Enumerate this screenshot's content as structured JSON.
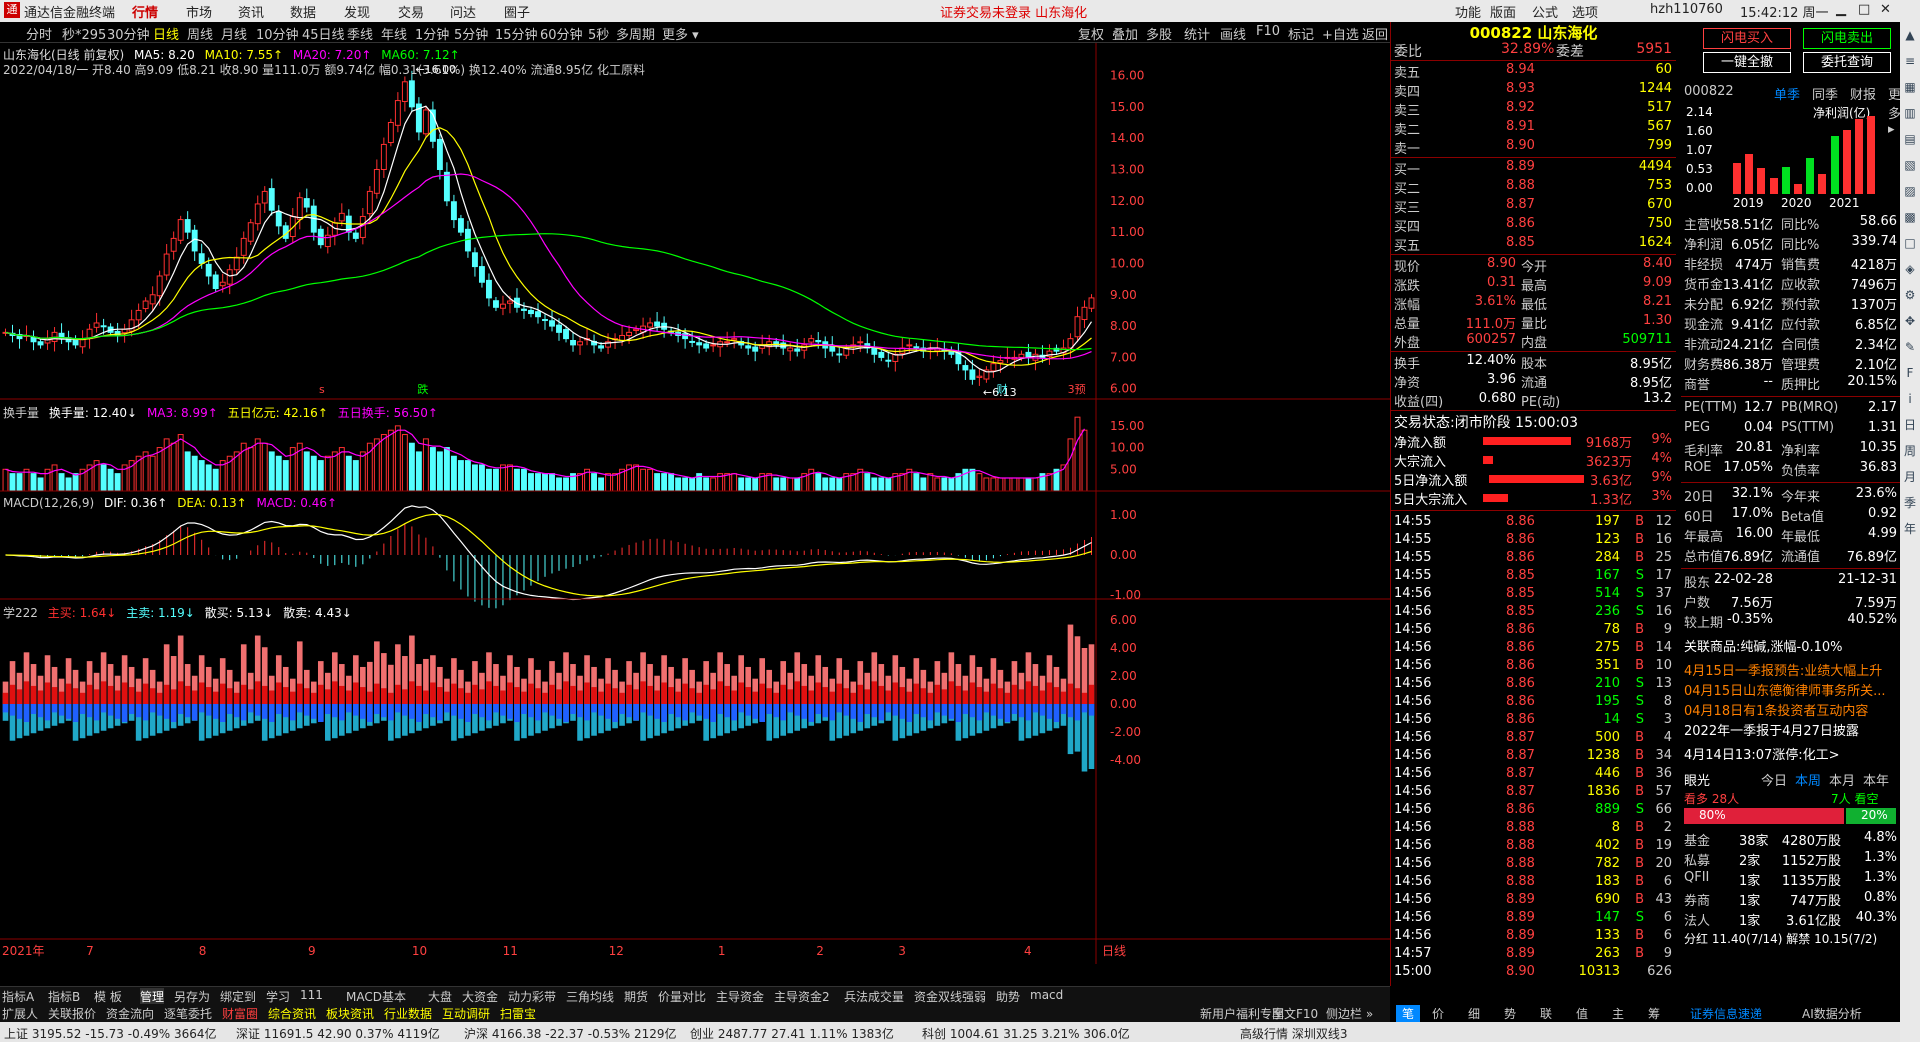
{
  "app": {
    "title": "通达信金融终端",
    "menu": [
      "行情",
      "市场",
      "资讯",
      "数据",
      "发现",
      "交易",
      "问达",
      "圈子"
    ],
    "notice": "证券交易未登录  山东海化",
    "right_menu": [
      "功能",
      "版面",
      "公式",
      "选项"
    ],
    "user": "hzh110760",
    "clock": "15:42:12 周一"
  },
  "periods": [
    "分时",
    "秒*295",
    "30分钟",
    "日线",
    "周线",
    "月线",
    "10分钟",
    "45日线",
    "季线",
    "年线",
    "1分钟",
    "5分钟",
    "15分钟",
    "60分钟",
    "5秒",
    "多周期",
    "更多 ▾"
  ],
  "toolbar": [
    "复权",
    "叠加",
    "多股",
    "统计",
    "画线",
    "F10",
    "标记",
    "+自选",
    "返回"
  ],
  "chart_header": {
    "title": "山东海化(日线 前复权)",
    "ma5": "MA5: 8.20",
    "ma10": "MA10: 7.55↑",
    "ma20": "MA20: 7.20↑",
    "ma60": "MA60: 7.12↑",
    "line2": "2022/04/18/一 开8.40 高9.09 低8.21 收8.90 量111.0万 额9.74亿 幅0.31(3.61%) 换12.40% 流通8.95亿 化工原料"
  },
  "price_axis": [
    "16.00",
    "15.00",
    "14.00",
    "13.00",
    "12.00",
    "11.00",
    "10.00",
    "9.00",
    "8.00",
    "7.00",
    "6.00"
  ],
  "annotations": {
    "high": "16.00",
    "low": "6.13",
    "marks": [
      "s",
      "跌",
      "财",
      "3预"
    ]
  },
  "vol_header": {
    "name": "换手量",
    "val": "换手量: 12.40↓",
    "ma3": "MA3: 8.99↑",
    "d5": "五日亿元: 42.16↑",
    "h5": "五日换手: 56.50↑"
  },
  "vol_axis": [
    "15.00",
    "10.00",
    "5.00"
  ],
  "macd_header": {
    "name": "MACD(12,26,9)",
    "dif": "DIF: 0.36↑",
    "dea": "DEA: 0.13↑",
    "macd": "MACD: 0.46↑"
  },
  "macd_axis": [
    "1.00",
    "0.00",
    "-1.00"
  ],
  "flow_header": {
    "name": "学222",
    "buy": "主买: 1.64↓",
    "sell": "主卖: 1.19↓",
    "sb": "散买: 5.13↓",
    "ss": "散卖: 4.43↓"
  },
  "flow_axis": [
    "6.00",
    "4.00",
    "2.00",
    "0.00",
    "-2.00",
    "-4.00"
  ],
  "x_axis": [
    "2021年",
    "7",
    "8",
    "9",
    "10",
    "11",
    "12",
    "1",
    "2",
    "3",
    "4",
    "日线"
  ],
  "right": {
    "code": "000822 山东海化",
    "wb": {
      "lbl": "委比",
      "v1": "32.89%",
      "lbl2": "委差",
      "v2": "5951"
    },
    "sells": [
      {
        "l": "卖五",
        "p": "8.94",
        "v": "60"
      },
      {
        "l": "卖四",
        "p": "8.93",
        "v": "1244"
      },
      {
        "l": "卖三",
        "p": "8.92",
        "v": "517"
      },
      {
        "l": "卖二",
        "p": "8.91",
        "v": "567"
      },
      {
        "l": "卖一",
        "p": "8.90",
        "v": "799"
      }
    ],
    "buys": [
      {
        "l": "买一",
        "p": "8.89",
        "v": "4494"
      },
      {
        "l": "买二",
        "p": "8.88",
        "v": "753"
      },
      {
        "l": "买三",
        "p": "8.87",
        "v": "670"
      },
      {
        "l": "买四",
        "p": "8.86",
        "v": "750"
      },
      {
        "l": "买五",
        "p": "8.85",
        "v": "1624"
      }
    ],
    "quote": [
      [
        "现价",
        "8.90",
        "今开",
        "8.40"
      ],
      [
        "涨跌",
        "0.31",
        "最高",
        "9.09"
      ],
      [
        "涨幅",
        "3.61%",
        "最低",
        "8.21"
      ],
      [
        "总量",
        "111.0万",
        "量比",
        "1.30"
      ],
      [
        "外盘",
        "600257",
        "内盘",
        "509711"
      ]
    ],
    "quote2": [
      [
        "换手",
        "12.40%",
        "股本",
        "8.95亿"
      ],
      [
        "净资",
        "3.96",
        "流通",
        "8.95亿"
      ],
      [
        "收益(四)",
        "0.680",
        "PE(动)",
        "13.2"
      ]
    ],
    "status": "交易状态:闭市阶段 15:00:03",
    "flows": [
      [
        "净流入额",
        "9168万",
        "9%"
      ],
      [
        "大宗流入",
        "3623万",
        "4%"
      ],
      [
        "5日净流入额",
        "3.63亿",
        "9%"
      ],
      [
        "5日大宗流入",
        "1.33亿",
        "3%"
      ]
    ],
    "ticks": [
      [
        "14:55",
        "8.86",
        "197",
        "B",
        "12"
      ],
      [
        "14:55",
        "8.86",
        "123",
        "B",
        "16"
      ],
      [
        "14:55",
        "8.86",
        "284",
        "B",
        "25"
      ],
      [
        "14:55",
        "8.85",
        "167",
        "S",
        "17"
      ],
      [
        "14:56",
        "8.85",
        "514",
        "S",
        "37"
      ],
      [
        "14:56",
        "8.85",
        "236",
        "S",
        "16"
      ],
      [
        "14:56",
        "8.86",
        "78",
        "B",
        "9"
      ],
      [
        "14:56",
        "8.86",
        "275",
        "B",
        "14"
      ],
      [
        "14:56",
        "8.86",
        "351",
        "B",
        "10"
      ],
      [
        "14:56",
        "8.86",
        "210",
        "S",
        "13"
      ],
      [
        "14:56",
        "8.86",
        "195",
        "S",
        "8"
      ],
      [
        "14:56",
        "8.86",
        "14",
        "S",
        "3"
      ],
      [
        "14:56",
        "8.87",
        "500",
        "B",
        "4"
      ],
      [
        "14:56",
        "8.87",
        "1238",
        "B",
        "34"
      ],
      [
        "14:56",
        "8.87",
        "446",
        "B",
        "36"
      ],
      [
        "14:56",
        "8.87",
        "1836",
        "B",
        "57"
      ],
      [
        "14:56",
        "8.86",
        "889",
        "S",
        "66"
      ],
      [
        "14:56",
        "8.88",
        "8",
        "B",
        "2"
      ],
      [
        "14:56",
        "8.88",
        "402",
        "B",
        "19"
      ],
      [
        "14:56",
        "8.88",
        "782",
        "B",
        "20"
      ],
      [
        "14:56",
        "8.88",
        "183",
        "B",
        "6"
      ],
      [
        "14:56",
        "8.89",
        "690",
        "B",
        "43"
      ],
      [
        "14:56",
        "8.89",
        "147",
        "S",
        "6"
      ],
      [
        "14:56",
        "8.89",
        "133",
        "B",
        "6"
      ],
      [
        "14:57",
        "8.89",
        "263",
        "B",
        "9"
      ],
      [
        "15:00",
        "8.90",
        "10313",
        "",
        "626"
      ]
    ],
    "buttons": [
      "闪电买入",
      "闪电卖出",
      "一键全撤",
      "委托查询"
    ],
    "fin_tabs": [
      "000822",
      "单季",
      "同季",
      "财报",
      "更多 ▸"
    ],
    "fin_axis": [
      "2.14",
      "1.60",
      "1.07",
      "0.53",
      "0.00"
    ],
    "fin_title": "净利润(亿)",
    "fin_years": [
      "2019",
      "2020",
      "2021"
    ],
    "fin_bars": [
      {
        "v": 0.85,
        "c": "#ff3030"
      },
      {
        "v": 1.1,
        "c": "#ff3030"
      },
      {
        "v": 0.7,
        "c": "#ff3030"
      },
      {
        "v": 0.45,
        "c": "#ff3030"
      },
      {
        "v": 0.75,
        "c": "#00e020"
      },
      {
        "v": 0.28,
        "c": "#ff3030"
      },
      {
        "v": 1.0,
        "c": "#00e020"
      },
      {
        "v": 0.55,
        "c": "#ff3030"
      },
      {
        "v": 1.6,
        "c": "#00e020"
      },
      {
        "v": 1.75,
        "c": "#ff3030"
      },
      {
        "v": 2.05,
        "c": "#ff3030"
      },
      {
        "v": 2.14,
        "c": "#ff3030"
      }
    ],
    "fin": [
      [
        "主营收",
        "58.51亿",
        "同比%",
        "58.66"
      ],
      [
        "净利润",
        "6.05亿",
        "同比%",
        "339.74"
      ],
      [
        "非经损",
        "474万",
        "销售费",
        "4218万"
      ],
      [
        "货币金",
        "13.41亿",
        "应收款",
        "7496万"
      ],
      [
        "未分配",
        "6.92亿",
        "预付款",
        "1370万"
      ],
      [
        "现金流",
        "9.41亿",
        "应付款",
        "6.85亿"
      ],
      [
        "非流动",
        "24.21亿",
        "合同债",
        "2.34亿"
      ],
      [
        "财务费",
        "-86.38万",
        "管理费",
        "2.10亿"
      ],
      [
        "商誉",
        "--",
        "质押比",
        "20.15%"
      ],
      [
        "PE(TTM)",
        "12.7",
        "PB(MRQ)",
        "2.17"
      ],
      [
        "PEG",
        "0.04",
        "PS(TTM)",
        "1.31"
      ],
      [
        "毛利率",
        "20.81",
        "净利率",
        "10.35"
      ],
      [
        "ROE",
        "17.05%",
        "负债率",
        "36.83"
      ],
      [
        "20日",
        "32.1%",
        "今年来",
        "23.6%"
      ],
      [
        "60日",
        "17.0%",
        "Beta值",
        "0.92"
      ],
      [
        "年最高",
        "16.00",
        "年最低",
        "4.99"
      ],
      [
        "总市值",
        "76.89亿",
        "流通值",
        "76.89亿"
      ],
      [
        "股东",
        "22-02-28",
        "",
        "21-12-31"
      ],
      [
        "户数",
        "7.56万",
        "",
        "7.59万"
      ],
      [
        "较上期",
        "-0.35%",
        "",
        "40.52%"
      ]
    ],
    "news": [
      "关联商品:纯碱,涨幅-0.10%",
      "4月15日一季报预告:业绩大幅上升",
      "04月15日山东德衡律师事务所关...",
      "04月18日有1条投资者互动内容",
      "2022年一季报于4月27日披露",
      "4月14日13:07涨停:化工>"
    ],
    "eye": {
      "title": "眼光",
      "tabs": [
        "今日",
        "本周",
        "本月",
        "本年"
      ],
      "bull": "看多 28人",
      "bear": "7人 看空",
      "pct1": "80%",
      "pct2": "20%"
    },
    "holders": [
      [
        "基金",
        "38家",
        "4280万股",
        "4.8%"
      ],
      [
        "私募",
        "2家",
        "1152万股",
        "1.3%"
      ],
      [
        "QFII",
        "1家",
        "1135万股",
        "1.3%"
      ],
      [
        "券商",
        "1家",
        "747万股",
        "0.8%"
      ],
      [
        "法人",
        "1家",
        "3.61亿股",
        "40.3%"
      ]
    ],
    "holders_foot": "分红 11.40(7/14) 解禁 10.15(7/2)"
  },
  "tabs1": [
    "指标A",
    "指标B",
    "模 板",
    "管理",
    "另存为",
    "绑定到",
    "学习",
    "111",
    "MACD基本",
    "大盘",
    "大资金",
    "动力彩带",
    "三角均线",
    "期货",
    "价量对比",
    "主导资金",
    "主导资金2",
    "兵法成交量",
    "资金双线强弱",
    "助势",
    "macd"
  ],
  "tabs2": [
    "扩展人",
    "关联报价",
    "资金流向",
    "逐笔委托",
    "财富圈",
    "综合资讯",
    "板块资讯",
    "行业数据",
    "互动调研",
    "扫雷宝"
  ],
  "tabs2_right": [
    "新用户福利专享",
    "图文F10",
    "侧边栏 »"
  ],
  "rtabs": [
    "笔",
    "价",
    "细",
    "势",
    "联",
    "值",
    "主",
    "筹"
  ],
  "rtabs_right": [
    "证券信息速递",
    "AI数据分析"
  ],
  "statusbar": [
    "上证 3195.52 -15.73 -0.49% 3664亿",
    "深证 11691.5 42.90 0.37% 4119亿",
    "沪深 4166.38 -22.37 -0.53% 2129亿",
    "创业 2487.77 27.41 1.11% 1383亿",
    "科创 1004.61 31.25 3.21% 306.0亿",
    "高级行情 深圳双线3"
  ],
  "colors": {
    "up": "#ff3030",
    "down": "#54ffff",
    "ma5": "#ffffff",
    "ma10": "#ffff00",
    "ma20": "#ff00ff",
    "ma60": "#00ff00"
  },
  "chart_data": {
    "type": "candlestick",
    "title": "山东海化(日线 前复权)",
    "ylim": [
      5.8,
      16.4
    ],
    "series_note": "daily OHLC approx",
    "close": [
      7.8,
      7.7,
      7.6,
      7.7,
      7.5,
      7.4,
      7.6,
      7.8,
      7.6,
      7.5,
      7.4,
      7.6,
      7.9,
      8.1,
      8.0,
      7.8,
      7.7,
      7.9,
      8.2,
      8.5,
      8.8,
      9.0,
      9.6,
      10.3,
      10.8,
      11.4,
      11.0,
      10.4,
      10.0,
      9.6,
      9.2,
      9.4,
      9.8,
      10.2,
      10.8,
      11.3,
      11.9,
      12.3,
      11.7,
      11.2,
      10.8,
      11.5,
      12.1,
      11.8,
      11.0,
      10.6,
      10.9,
      11.3,
      11.6,
      11.0,
      10.8,
      11.5,
      12.3,
      13.0,
      13.8,
      14.5,
      15.2,
      15.8,
      15.0,
      14.2,
      14.9,
      13.9,
      13.0,
      12.0,
      11.4,
      11.0,
      10.4,
      9.9,
      9.4,
      8.9,
      8.6,
      8.7,
      8.8,
      8.6,
      8.5,
      8.4,
      8.3,
      8.2,
      8.0,
      7.8,
      7.6,
      7.4,
      7.5,
      7.6,
      7.4,
      7.3,
      7.5,
      7.6,
      7.7,
      7.8,
      7.9,
      8.0,
      8.1,
      8.0,
      7.9,
      7.8,
      7.7,
      7.6,
      7.5,
      7.4,
      7.3,
      7.4,
      7.5,
      7.5,
      7.6,
      7.4,
      7.3,
      7.2,
      7.4,
      7.5,
      7.4,
      7.3,
      7.3,
      7.2,
      7.4,
      7.6,
      7.5,
      7.3,
      7.2,
      7.1,
      7.3,
      7.4,
      7.5,
      7.3,
      7.1,
      7.0,
      6.9,
      7.1,
      7.3,
      7.4,
      7.3,
      7.2,
      7.3,
      7.3,
      7.2,
      7.1,
      6.8,
      6.6,
      6.3,
      6.4,
      6.6,
      6.8,
      6.9,
      7.0,
      7.0,
      7.1,
      7.0,
      7.1,
      7.0,
      7.2,
      7.2,
      7.3,
      7.6,
      8.3,
      8.6,
      8.9
    ],
    "vol": [
      5,
      4,
      4,
      5,
      4,
      3,
      5,
      6,
      4,
      3,
      4,
      5,
      6,
      7,
      6,
      5,
      4,
      6,
      7,
      8,
      9,
      8,
      10,
      12,
      11,
      13,
      9,
      8,
      7,
      6,
      5,
      7,
      8,
      9,
      11,
      10,
      12,
      11,
      9,
      8,
      7,
      10,
      11,
      9,
      8,
      7,
      8,
      9,
      10,
      8,
      7,
      9,
      11,
      12,
      13,
      14,
      15,
      13,
      11,
      9,
      12,
      10,
      9,
      10,
      8,
      7,
      7,
      6,
      6,
      5,
      5,
      6,
      6,
      5,
      5,
      4,
      4,
      4,
      4,
      3,
      3,
      4,
      4,
      5,
      4,
      3,
      4,
      4,
      5,
      6,
      6,
      5,
      5,
      4,
      4,
      4,
      3,
      3,
      3,
      4,
      3,
      3,
      4,
      4,
      4,
      3,
      3,
      3,
      4,
      4,
      3,
      3,
      3,
      3,
      4,
      5,
      4,
      3,
      3,
      3,
      4,
      4,
      5,
      4,
      3,
      3,
      3,
      4,
      4,
      5,
      4,
      3,
      4,
      3,
      3,
      3,
      4,
      5,
      5,
      4,
      3,
      3,
      3,
      3,
      3,
      3,
      3,
      3,
      4,
      4,
      5,
      6,
      12,
      17,
      14
    ]
  }
}
